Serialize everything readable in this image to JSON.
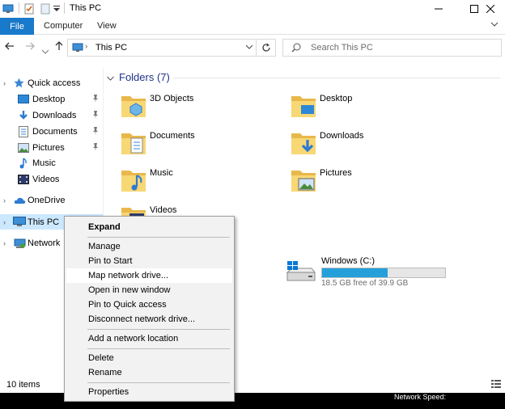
{
  "window": {
    "title": "This PC",
    "controls": [
      "minimize",
      "maximize",
      "close"
    ]
  },
  "ribbon": {
    "tabs": [
      "File",
      "Computer",
      "View"
    ]
  },
  "navigation": {
    "address": "This PC",
    "search_placeholder": "Search This PC"
  },
  "nav_pane": {
    "quick_access": "Quick access",
    "quick_items": [
      "Desktop",
      "Downloads",
      "Documents",
      "Pictures",
      "Music",
      "Videos"
    ],
    "onedrive": "OneDrive",
    "this_pc": "This PC",
    "network": "Network"
  },
  "content": {
    "folders_header": "Folders (7)",
    "folders": [
      "3D Objects",
      "Desktop",
      "Documents",
      "Downloads",
      "Music",
      "Pictures",
      "Videos"
    ],
    "drive": {
      "name": "Windows (C:)",
      "free_text": "18.5 GB free of 39.9 GB",
      "used_fraction": 0.536
    }
  },
  "status": {
    "item_count": "10 items"
  },
  "taskbar": {
    "network_speed": "Network Speed:"
  },
  "context_menu": {
    "items": [
      "Expand",
      "Manage",
      "Pin to Start",
      "Map network drive...",
      "Open in new window",
      "Pin to Quick access",
      "Disconnect network drive...",
      "Add a network location",
      "Delete",
      "Rename",
      "Properties"
    ]
  },
  "colors": {
    "accent": "#1979ca",
    "folder_yellow": "#f8d775",
    "drive_fill": "#26a0da",
    "selection": "#cce8ff"
  }
}
